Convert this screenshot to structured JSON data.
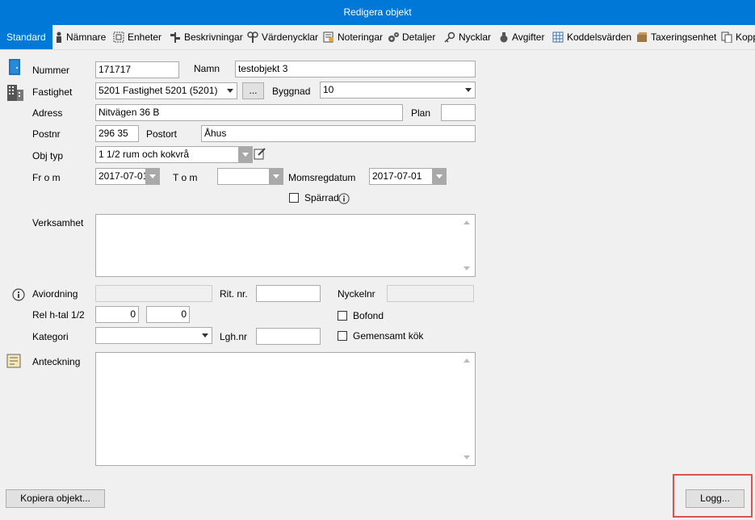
{
  "window": {
    "title": "Redigera objekt"
  },
  "tabs": [
    {
      "label": "Standard",
      "icon": "none"
    },
    {
      "label": "Nämnare",
      "icon": "person-icon"
    },
    {
      "label": "Enheter",
      "icon": "units-icon"
    },
    {
      "label": "Beskrivningar",
      "icon": "signpost-icon"
    },
    {
      "label": "Värdenycklar",
      "icon": "value-key-icon"
    },
    {
      "label": "Noteringar",
      "icon": "notes-icon"
    },
    {
      "label": "Detaljer",
      "icon": "gears-icon"
    },
    {
      "label": "Nycklar",
      "icon": "key-icon"
    },
    {
      "label": "Avgifter",
      "icon": "moneybag-icon"
    },
    {
      "label": "Koddelsvärden",
      "icon": "grid-icon"
    },
    {
      "label": "Taxeringsenhet",
      "icon": "box-icon"
    },
    {
      "label": "Kopp",
      "icon": "copy-icon"
    }
  ],
  "form": {
    "nummer": {
      "label": "Nummer",
      "value": "171717"
    },
    "namn": {
      "label": "Namn",
      "value": "testobjekt 3"
    },
    "fastighet": {
      "label": "Fastighet",
      "value": "5201 Fastighet 5201 (5201)",
      "browse": "..."
    },
    "byggnad": {
      "label": "Byggnad",
      "value": "10"
    },
    "adress": {
      "label": "Adress",
      "value": "Nitvägen 36 B"
    },
    "plan": {
      "label": "Plan",
      "value": ""
    },
    "postnr": {
      "label": "Postnr",
      "value": "296 35"
    },
    "postort": {
      "label": "Postort",
      "value": "Åhus"
    },
    "objtyp": {
      "label": "Obj typ",
      "value": "1 1/2 rum och kokvrå"
    },
    "from": {
      "label": "Fr o m",
      "value": "2017-07-01"
    },
    "tom": {
      "label": "T o m",
      "value": ""
    },
    "momsregdatum": {
      "label": "Momsregdatum",
      "value": "2017-07-01"
    },
    "sparrad": {
      "label": "Spärrad",
      "checked": false
    },
    "verksamhet": {
      "label": "Verksamhet",
      "value": ""
    },
    "aviordning": {
      "label": "Aviordning",
      "value": ""
    },
    "ritnr": {
      "label": "Rit. nr.",
      "value": ""
    },
    "nyckelnr": {
      "label": "Nyckelnr",
      "value": ""
    },
    "relhtal": {
      "label": "Rel h-tal 1/2",
      "value1": "0",
      "value2": "0"
    },
    "bofond": {
      "label": "Bofond",
      "checked": false
    },
    "kategori": {
      "label": "Kategori",
      "value": ""
    },
    "lghnr": {
      "label": "Lgh.nr",
      "value": ""
    },
    "gemensamtkok": {
      "label": "Gemensamt kök",
      "checked": false
    },
    "anteckning": {
      "label": "Anteckning",
      "value": ""
    }
  },
  "buttons": {
    "kopiera": "Kopiera objekt...",
    "logg": "Logg..."
  },
  "colors": {
    "accent": "#0078d7",
    "highlight": "#d9534f"
  }
}
